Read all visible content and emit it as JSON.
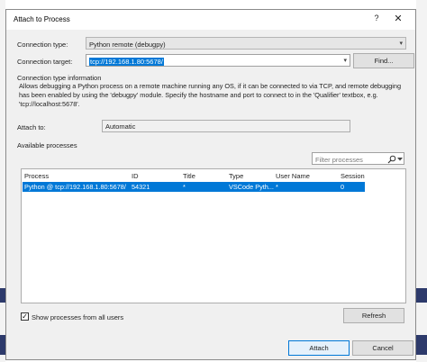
{
  "dialog": {
    "title": "Attach to Process",
    "help_label": "?",
    "close_label": "✕"
  },
  "connection_type": {
    "label": "Connection type:",
    "value": "Python remote (debugpy)"
  },
  "connection_target": {
    "label": "Connection target:",
    "value": "tcp://192.168.1.80:5678/",
    "find_button": "Find..."
  },
  "info": {
    "heading": "Connection type information",
    "text": "Allows debugging a Python process on a remote machine running any OS, if it can be connected to via TCP, and remote debugging has been enabled by using the 'debugpy' module. Specify the hostname and port to connect to in the 'Qualifier' textbox, e.g. 'tcp://localhost:5678'."
  },
  "attach_to": {
    "label": "Attach to:",
    "value": "Automatic"
  },
  "available_processes": {
    "label": "Available processes",
    "filter_placeholder": "Filter processes",
    "columns": [
      "Process",
      "ID",
      "Title",
      "Type",
      "User Name",
      "Session"
    ],
    "rows": [
      {
        "process": "Python @ tcp://192.168.1.80:5678/",
        "id": "54321",
        "title": "*",
        "type": "VSCode Pyth...",
        "user_name": "*",
        "session": "0",
        "selected": true
      }
    ]
  },
  "show_all_users": {
    "label": "Show processes from all users",
    "checked": true
  },
  "buttons": {
    "refresh": "Refresh",
    "attach": "Attach",
    "cancel": "Cancel"
  },
  "icons": {
    "search": "search-icon",
    "dropdown": "chevron-down-icon",
    "help": "help-icon",
    "close": "close-icon",
    "checkmark": "checkmark-icon"
  },
  "colors": {
    "selection": "#0078d7",
    "dialog_bg": "#f0f0f0",
    "background_accent": "#2d3a6b"
  }
}
